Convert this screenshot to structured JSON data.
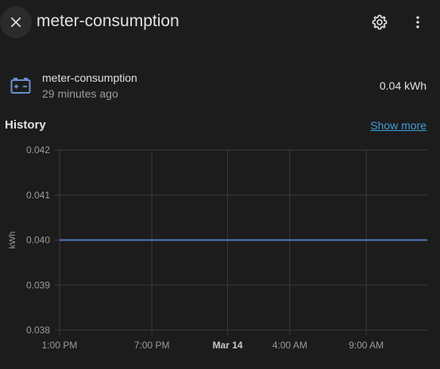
{
  "header": {
    "title": "meter-consumption",
    "close_icon": "close-icon",
    "settings_icon": "gear-icon",
    "menu_icon": "more-vertical-icon"
  },
  "entity": {
    "icon": "battery-charging-icon",
    "name": "meter-consumption",
    "last_changed": "29 minutes ago",
    "state": "0.04 kWh"
  },
  "history": {
    "label": "History",
    "show_more": "Show more"
  },
  "colors": {
    "background": "#1c1c1c",
    "line": "#4e7ab6",
    "link": "#3f9fd8",
    "grid": "#3a3a3a",
    "icon": "#6a8fd0"
  },
  "chart_data": {
    "type": "line",
    "xlabel": "",
    "ylabel": "kWh",
    "ylim": [
      0.038,
      0.042
    ],
    "y_ticks": [
      "0.042",
      "0.041",
      "0.040",
      "0.039",
      "0.038"
    ],
    "x_ticks": [
      {
        "label": "1:00 PM",
        "bold": false
      },
      {
        "label": "7:00 PM",
        "bold": false
      },
      {
        "label": "Mar 14",
        "bold": true
      },
      {
        "label": "4:00 AM",
        "bold": false
      },
      {
        "label": "9:00 AM",
        "bold": false
      }
    ],
    "grid": true,
    "series": [
      {
        "x": [
          "1:00 PM",
          "end"
        ],
        "values": [
          0.04,
          0.04
        ]
      }
    ]
  }
}
